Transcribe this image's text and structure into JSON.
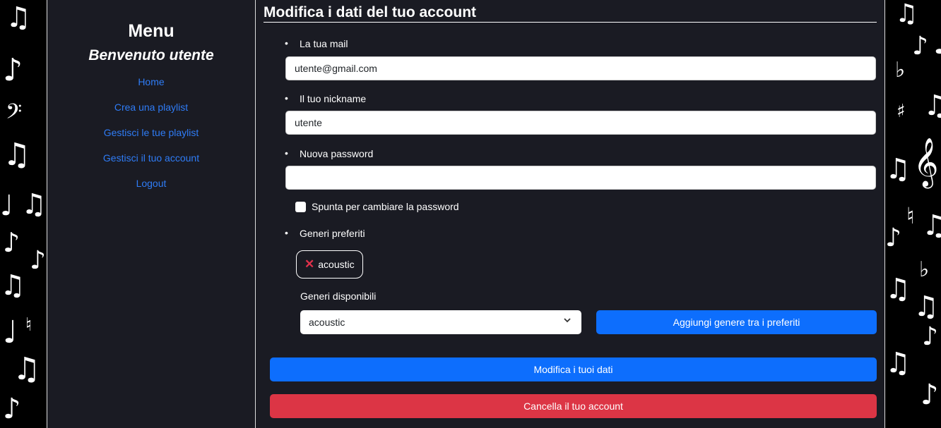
{
  "sidebar": {
    "title": "Menu",
    "welcome": "Benvenuto utente",
    "items": [
      {
        "label": "Home"
      },
      {
        "label": "Crea una playlist"
      },
      {
        "label": "Gestisci le tue playlist"
      },
      {
        "label": "Gestisci il tuo account"
      },
      {
        "label": "Logout"
      }
    ],
    "link_color": "#2f7cf6"
  },
  "main": {
    "title": "Modifica i dati del tuo account",
    "email_label": "La tua mail",
    "email_value": "utente@gmail.com",
    "nickname_label": "Il tuo nickname",
    "nickname_value": "utente",
    "password_label": "Nuova password",
    "password_value": "",
    "checkbox_label": "Spunta per cambiare la password",
    "checkbox_checked": false,
    "favorites_label": "Generi preferiti",
    "favorite_genres": [
      "acoustic"
    ],
    "available_label": "Generi disponibili",
    "available_selected": "acoustic",
    "add_button": "Aggiungi genere tra i preferiti",
    "modify_button": "Modifica i tuoi dati",
    "delete_button": "Cancella il tuo account"
  },
  "colors": {
    "background": "#1a1b23",
    "primary": "#0d6efd",
    "danger": "#dc3545",
    "remove_icon": "#e0314b"
  },
  "icons": {
    "remove": "close-icon",
    "select": "chevron-down-icon",
    "decoration": "music-notes"
  }
}
